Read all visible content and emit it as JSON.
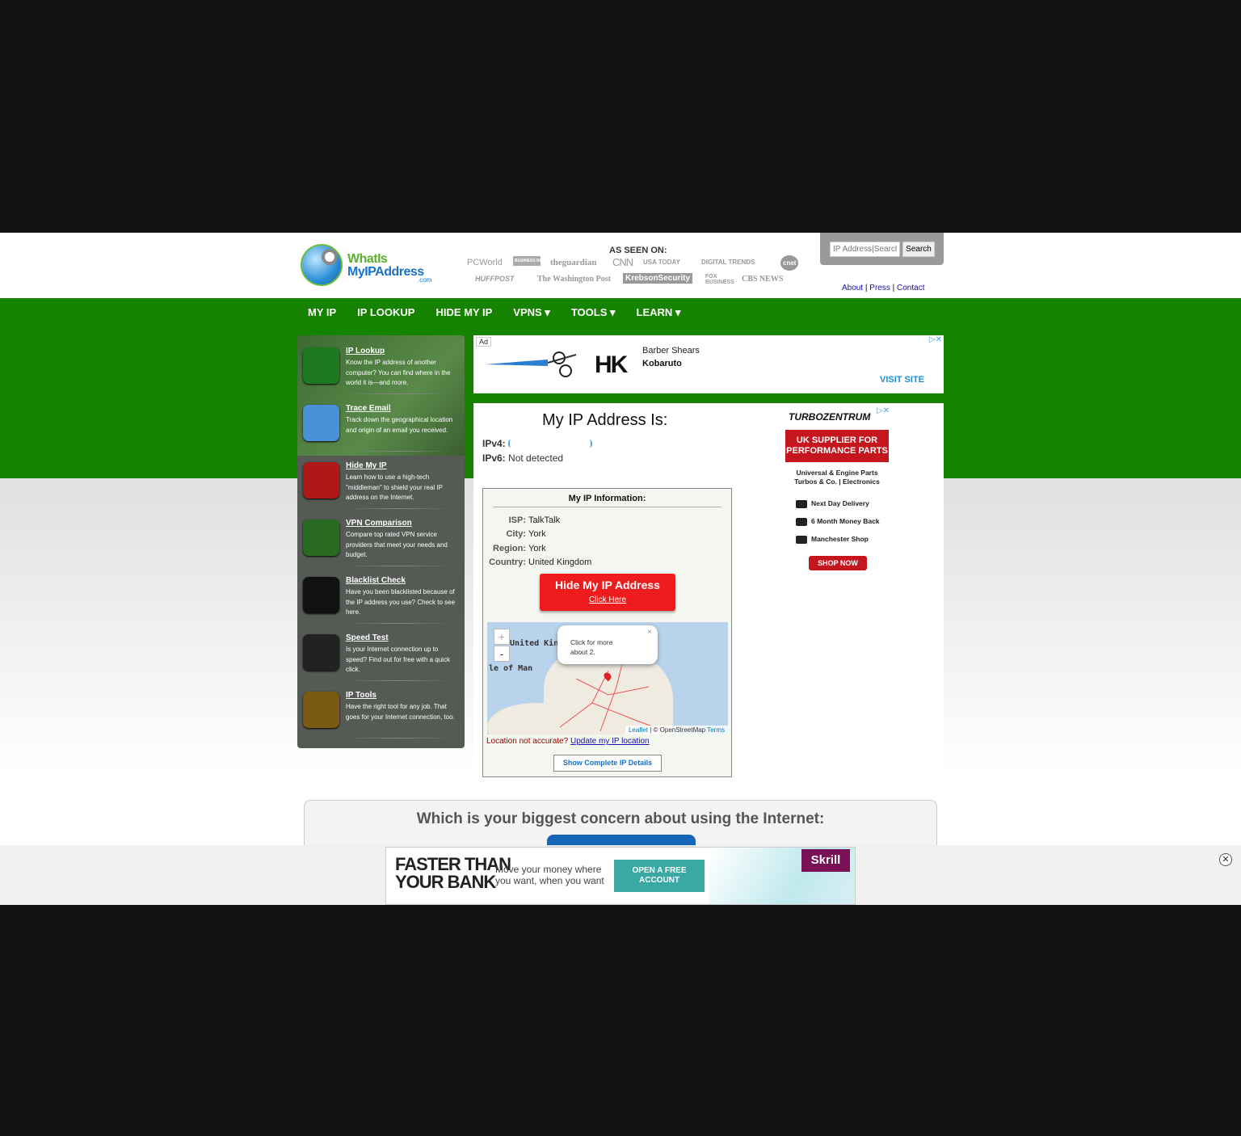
{
  "header": {
    "logo_line1": "WhatIs",
    "logo_line2": "MyIPAddress",
    "logo_suffix": ".com",
    "as_seen_on": "AS SEEN ON:",
    "media": [
      "PCWorld",
      "BUSINESS INSIDER",
      "theguardian",
      "CNN",
      "USA TODAY",
      "DIGITAL TRENDS",
      "cnet",
      "HUFFPOST",
      "The Washington Post",
      "KrebsonSecurity",
      "FOX BUSINESS",
      "CBS NEWS"
    ],
    "search_placeholder": "IP Address|Search",
    "search_button": "Search",
    "links": [
      "About",
      "Press",
      "Contact"
    ]
  },
  "nav": [
    "MY IP",
    "IP LOOKUP",
    "HIDE MY IP",
    "VPNS ▾",
    "TOOLS ▾",
    "LEARN ▾"
  ],
  "sidebar": [
    {
      "title": "IP Lookup",
      "desc": "Know the IP address of another computer? You can find where in the world it is—and more.",
      "icon": "ip-lookup-icon",
      "color": "#1e7a1e"
    },
    {
      "title": "Trace Email",
      "desc": "Track down the geographical location and origin of an email you received.",
      "icon": "trace-email-icon",
      "color": "#4a90d9"
    },
    {
      "title": "Hide My IP",
      "desc": "Learn how to use a high-tech \"middleman\" to shield your real IP address on the Internet.",
      "icon": "hide-ip-icon",
      "color": "#b01818"
    },
    {
      "title": "VPN Comparison",
      "desc": "Compare top rated VPN service providers that meet your needs and budget.",
      "icon": "vpn-icon",
      "color": "#2a6b22"
    },
    {
      "title": "Blacklist Check",
      "desc": "Have you been blacklisted because of the IP address you use? Check to see here.",
      "icon": "blacklist-icon",
      "color": "#111111"
    },
    {
      "title": "Speed Test",
      "desc": "Is your Internet connection up to speed? Find out for free with a quick click.",
      "icon": "speed-test-icon",
      "color": "#222222"
    },
    {
      "title": "IP Tools",
      "desc": "Have the right tool for any job. That goes for your Internet connection, too.",
      "icon": "ip-tools-icon",
      "color": "#7a5a10"
    }
  ],
  "ad_top": {
    "label": "Ad",
    "headline": "Barber Shears",
    "brand": "Kobaruto",
    "cta": "VISIT SITE",
    "logo": "HK"
  },
  "main": {
    "title": "My IP Address Is:",
    "ipv4_label": "IPv4:",
    "ipv4_value": "",
    "ipv6_label": "IPv6:",
    "ipv6_value": "Not detected",
    "info_title": "My IP Information:",
    "isp_label": "ISP:",
    "isp": "TalkTalk",
    "city_label": "City:",
    "city": "York",
    "region_label": "Region:",
    "region": "York",
    "country_label": "Country:",
    "country": "United Kingdom",
    "hide_title": "Hide My IP Address",
    "hide_link": "Click Here",
    "map_popup_line1": "Click for more",
    "map_popup_line2": "about 2.",
    "map_label1": "United King",
    "map_label2": "le of Man",
    "map_attr_leaflet": "Leaflet",
    "map_attr_osm": "| © OpenStreetMap",
    "map_attr_terms": "Terms",
    "loc_not_accurate": "Location not accurate?",
    "update_link": "Update my IP location",
    "show_details": "Show Complete IP Details"
  },
  "ad_right": {
    "brand": "TURBOZENTRUM",
    "banner": "UK SUPPLIER FOR PERFORMANCE PARTS",
    "sub1": "Universal & Engine Parts",
    "sub2": "Turbos & Co. | Electronics",
    "f1": "Next Day Delivery",
    "f2": "6 Month Money Back",
    "f3": "Manchester Shop",
    "cta": "SHOP NOW"
  },
  "poll": {
    "question": "Which is your biggest concern about using the Internet:"
  },
  "bottom_ad": {
    "headline1": "FASTER THAN",
    "headline2": "YOUR BANK",
    "sub1": "Move your money where",
    "sub2": "you want, when you want",
    "cta1": "OPEN A FREE",
    "cta2": "ACCOUNT",
    "brand": "Skrill"
  },
  "colors": {
    "nav_green": "#158200",
    "hide_red": "#ee1c1c",
    "sidebar_gray": "#555a55"
  }
}
